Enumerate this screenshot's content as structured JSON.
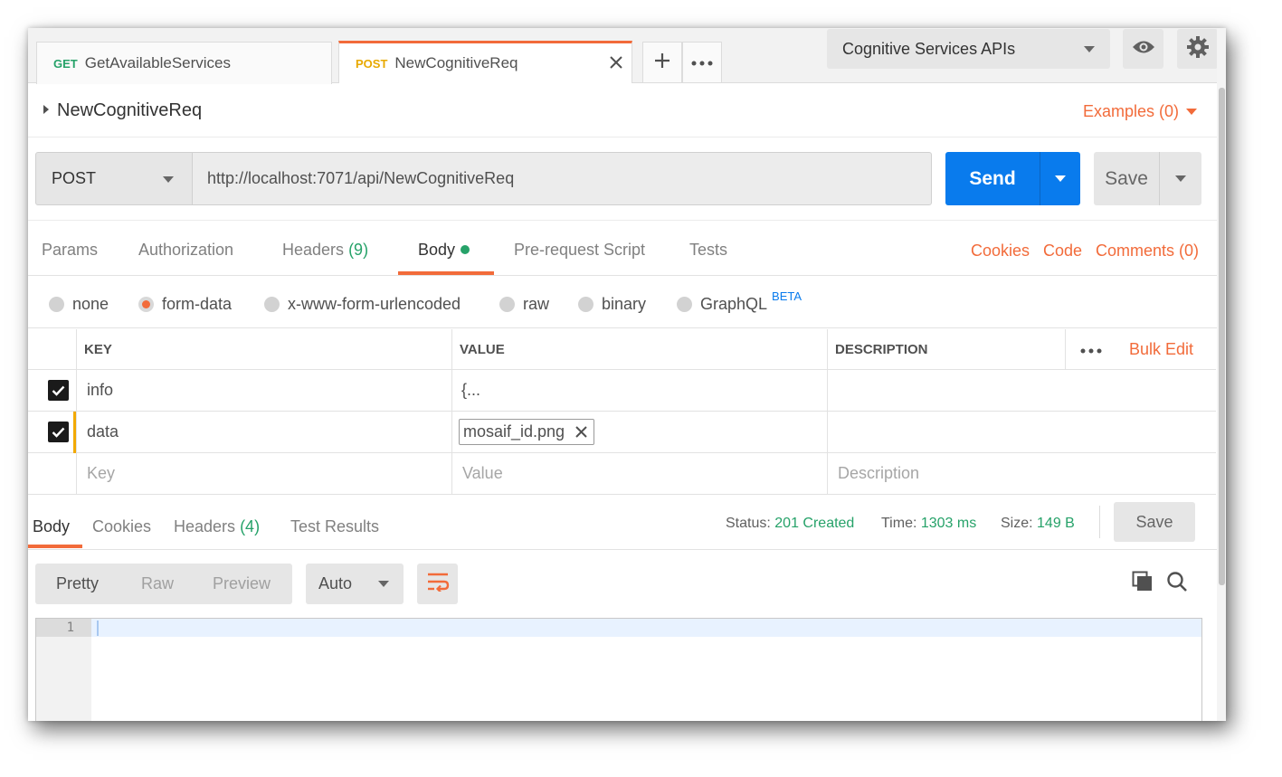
{
  "tabs": [
    {
      "method": "GET",
      "name": "GetAvailableServices"
    },
    {
      "method": "POST",
      "name": "NewCognitiveReq"
    }
  ],
  "environment": {
    "selected": "Cognitive Services APIs"
  },
  "request": {
    "name": "NewCognitiveReq",
    "examples_label": "Examples (0)",
    "method": "POST",
    "url": "http://localhost:7071/api/NewCognitiveReq",
    "send_label": "Send",
    "save_label": "Save"
  },
  "request_tabs": {
    "params": "Params",
    "authorization": "Authorization",
    "headers": "Headers",
    "headers_count": "(9)",
    "body": "Body",
    "prerequest": "Pre-request Script",
    "tests": "Tests",
    "cookies": "Cookies",
    "code": "Code",
    "comments": "Comments (0)"
  },
  "body_types": {
    "none": "none",
    "form_data": "form-data",
    "urlencoded": "x-www-form-urlencoded",
    "raw": "raw",
    "binary": "binary",
    "graphql": "GraphQL",
    "beta": "BETA",
    "selected": "form-data"
  },
  "form_table": {
    "headers": {
      "key": "KEY",
      "value": "VALUE",
      "description": "DESCRIPTION",
      "bulk_edit": "Bulk Edit"
    },
    "rows": [
      {
        "key": "info",
        "value": "{...",
        "checked": true
      },
      {
        "key": "data",
        "value": "mosaif_id.png",
        "checked": true,
        "type": "file"
      }
    ],
    "placeholders": {
      "key": "Key",
      "value": "Value",
      "description": "Description"
    }
  },
  "response": {
    "tabs": {
      "body": "Body",
      "cookies": "Cookies",
      "headers": "Headers",
      "headers_count": "(4)",
      "test_results": "Test Results"
    },
    "status_label": "Status:",
    "status_value": "201 Created",
    "time_label": "Time:",
    "time_value": "1303 ms",
    "size_label": "Size:",
    "size_value": "149 B",
    "save_label": "Save",
    "view_modes": {
      "pretty": "Pretty",
      "raw": "Raw",
      "preview": "Preview"
    },
    "format": "Auto",
    "editor_line": "1"
  },
  "colors": {
    "accent": "#f26b3a",
    "send": "#097bed",
    "success": "#26a269",
    "post": "#e8a900"
  }
}
